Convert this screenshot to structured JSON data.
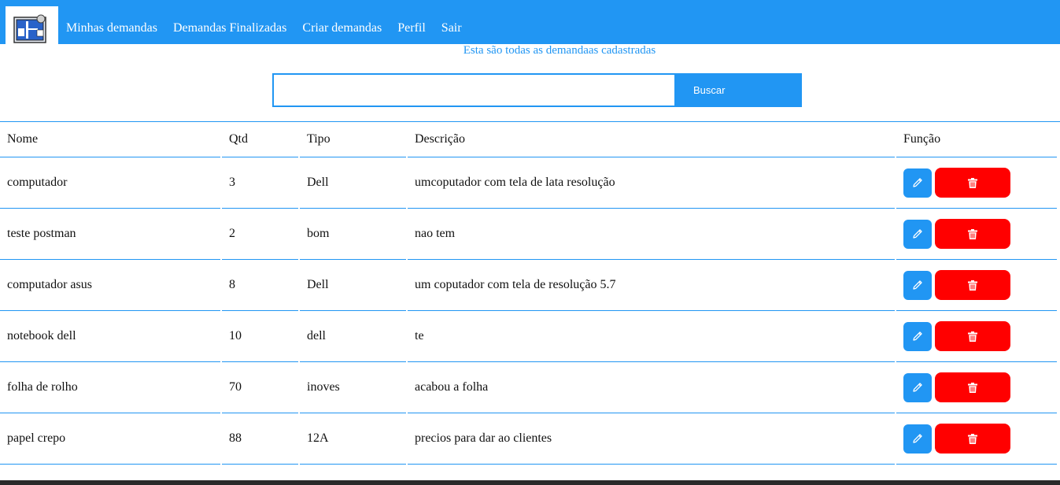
{
  "navbar": {
    "logo_icon": "app-logo-icon",
    "links": [
      {
        "label": "Minhas demandas"
      },
      {
        "label": "Demandas Finalizadas"
      },
      {
        "label": "Criar demandas"
      },
      {
        "label": "Perfil"
      },
      {
        "label": "Sair"
      }
    ],
    "color": "#2196f3"
  },
  "subtitle": "Esta são todas as demandaas cadastradas",
  "search": {
    "value": "",
    "placeholder": "",
    "button_label": "Buscar"
  },
  "table": {
    "headers": {
      "nome": "Nome",
      "qtd": "Qtd",
      "tipo": "Tipo",
      "descricao": "Descrição",
      "funcao": "Função"
    },
    "rows": [
      {
        "nome": "computador",
        "qtd": "3",
        "tipo": "Dell",
        "descricao": "umcoputador com tela de lata resolução"
      },
      {
        "nome": "teste postman",
        "qtd": "2",
        "tipo": "bom",
        "descricao": "nao tem"
      },
      {
        "nome": "computador asus",
        "qtd": "8",
        "tipo": "Dell",
        "descricao": "um coputador com tela de resolução 5.7"
      },
      {
        "nome": "notebook dell",
        "qtd": "10",
        "tipo": "dell",
        "descricao": "te"
      },
      {
        "nome": "folha de rolho",
        "qtd": "70",
        "tipo": "inoves",
        "descricao": "acabou a folha"
      },
      {
        "nome": "papel crepo",
        "qtd": "88",
        "tipo": "12A",
        "descricao": "precios para dar ao clientes"
      }
    ],
    "edit_icon": "pencil-icon",
    "delete_icon": "trash-icon",
    "edit_color": "#2196f3",
    "delete_color": "#ff0000"
  }
}
